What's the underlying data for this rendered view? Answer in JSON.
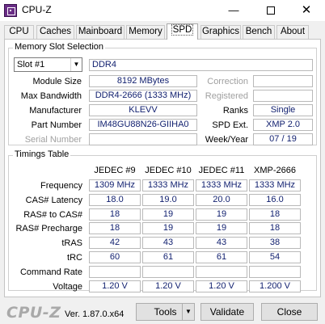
{
  "window": {
    "title": "CPU-Z",
    "minimize": "—",
    "close": "✕"
  },
  "tabs": [
    {
      "label": "CPU"
    },
    {
      "label": "Caches"
    },
    {
      "label": "Mainboard"
    },
    {
      "label": "Memory"
    },
    {
      "label": "SPD"
    },
    {
      "label": "Graphics"
    },
    {
      "label": "Bench"
    },
    {
      "label": "About"
    }
  ],
  "active_tab": "SPD",
  "slot_group": {
    "title": "Memory Slot Selection",
    "slot_select": "Slot #1",
    "memory_type": "DDR4",
    "rows": {
      "module_size": {
        "label": "Module Size",
        "value": "8192 MBytes"
      },
      "max_bandwidth": {
        "label": "Max Bandwidth",
        "value": "DDR4-2666 (1333 MHz)"
      },
      "manufacturer": {
        "label": "Manufacturer",
        "value": "KLEVV"
      },
      "part_number": {
        "label": "Part Number",
        "value": "IM48GU88N26-GIIHA0"
      },
      "serial_number": {
        "label": "Serial Number",
        "value": ""
      }
    },
    "right_rows": {
      "correction": {
        "label": "Correction",
        "value": ""
      },
      "registered": {
        "label": "Registered",
        "value": ""
      },
      "ranks": {
        "label": "Ranks",
        "value": "Single"
      },
      "spd_ext": {
        "label": "SPD Ext.",
        "value": "XMP 2.0"
      },
      "week_year": {
        "label": "Week/Year",
        "value": "07 / 19"
      }
    }
  },
  "timings": {
    "title": "Timings Table",
    "columns": [
      "JEDEC #9",
      "JEDEC #10",
      "JEDEC #11",
      "XMP-2666"
    ],
    "rows": [
      {
        "label": "Frequency",
        "values": [
          "1309 MHz",
          "1333 MHz",
          "1333 MHz",
          "1333 MHz"
        ]
      },
      {
        "label": "CAS# Latency",
        "values": [
          "18.0",
          "19.0",
          "20.0",
          "16.0"
        ]
      },
      {
        "label": "RAS# to CAS#",
        "values": [
          "18",
          "19",
          "19",
          "18"
        ]
      },
      {
        "label": "RAS# Precharge",
        "values": [
          "18",
          "19",
          "19",
          "18"
        ]
      },
      {
        "label": "tRAS",
        "values": [
          "42",
          "43",
          "43",
          "38"
        ]
      },
      {
        "label": "tRC",
        "values": [
          "60",
          "61",
          "61",
          "54"
        ]
      },
      {
        "label": "Command Rate",
        "values": [
          "",
          "",
          "",
          ""
        ]
      },
      {
        "label": "Voltage",
        "values": [
          "1.20 V",
          "1.20 V",
          "1.20 V",
          "1.200 V"
        ]
      }
    ]
  },
  "footer": {
    "logo": "CPU-Z",
    "version": "Ver. 1.87.0.x64",
    "tools_label": "Tools",
    "validate_label": "Validate",
    "close_label": "Close"
  },
  "icons": {
    "app": "cpu-z-app-icon",
    "minimize": "minimize-icon",
    "maximize": "maximize-icon",
    "close": "close-icon",
    "dropdown": "chevron-down-icon"
  }
}
